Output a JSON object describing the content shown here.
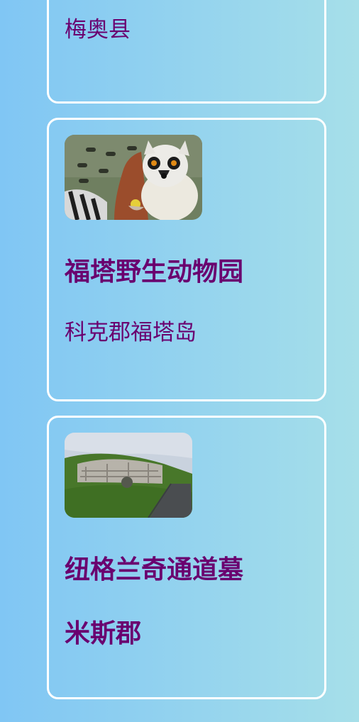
{
  "cards": [
    {
      "subtitle": "梅奥县"
    },
    {
      "image_alt": "lemur",
      "title": "福塔野生动物园",
      "subtitle": "科克郡福塔岛"
    },
    {
      "image_alt": "passage tomb",
      "title": "纽格兰奇通道墓",
      "subtitle": "米斯郡"
    }
  ],
  "colors": {
    "background_start": "#80c6f4",
    "background_end": "#a6dfe9",
    "card_border": "#ffffff",
    "text": "#6a006f"
  }
}
